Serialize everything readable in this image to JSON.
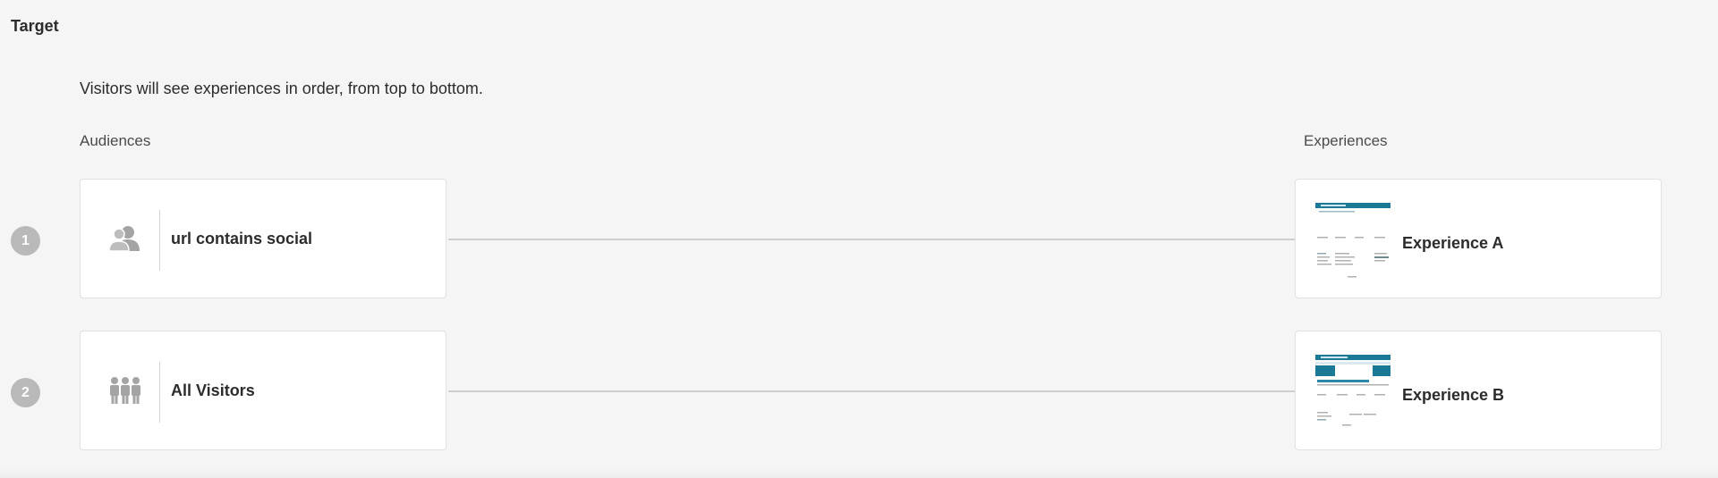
{
  "section": {
    "title": "Target"
  },
  "order_note": "Visitors will see experiences in order, from top to bottom.",
  "columns": {
    "audiences_label": "Audiences",
    "experiences_label": "Experiences"
  },
  "rows": [
    {
      "order": "1",
      "audience": {
        "icon": "user-group-icon",
        "label": "url contains social"
      },
      "experience": {
        "thumbnail": "experience-thumbnail",
        "label": "Experience A"
      }
    },
    {
      "order": "2",
      "audience": {
        "icon": "all-visitors-icon",
        "label": "All Visitors"
      },
      "experience": {
        "thumbnail": "experience-thumbnail",
        "label": "Experience B"
      }
    }
  ],
  "colors": {
    "background": "#f5f5f5",
    "card": "#ffffff",
    "badge": "#b9b9b9",
    "connector": "#cfcfcf",
    "thumbnail_accent": "#1a7a96"
  }
}
